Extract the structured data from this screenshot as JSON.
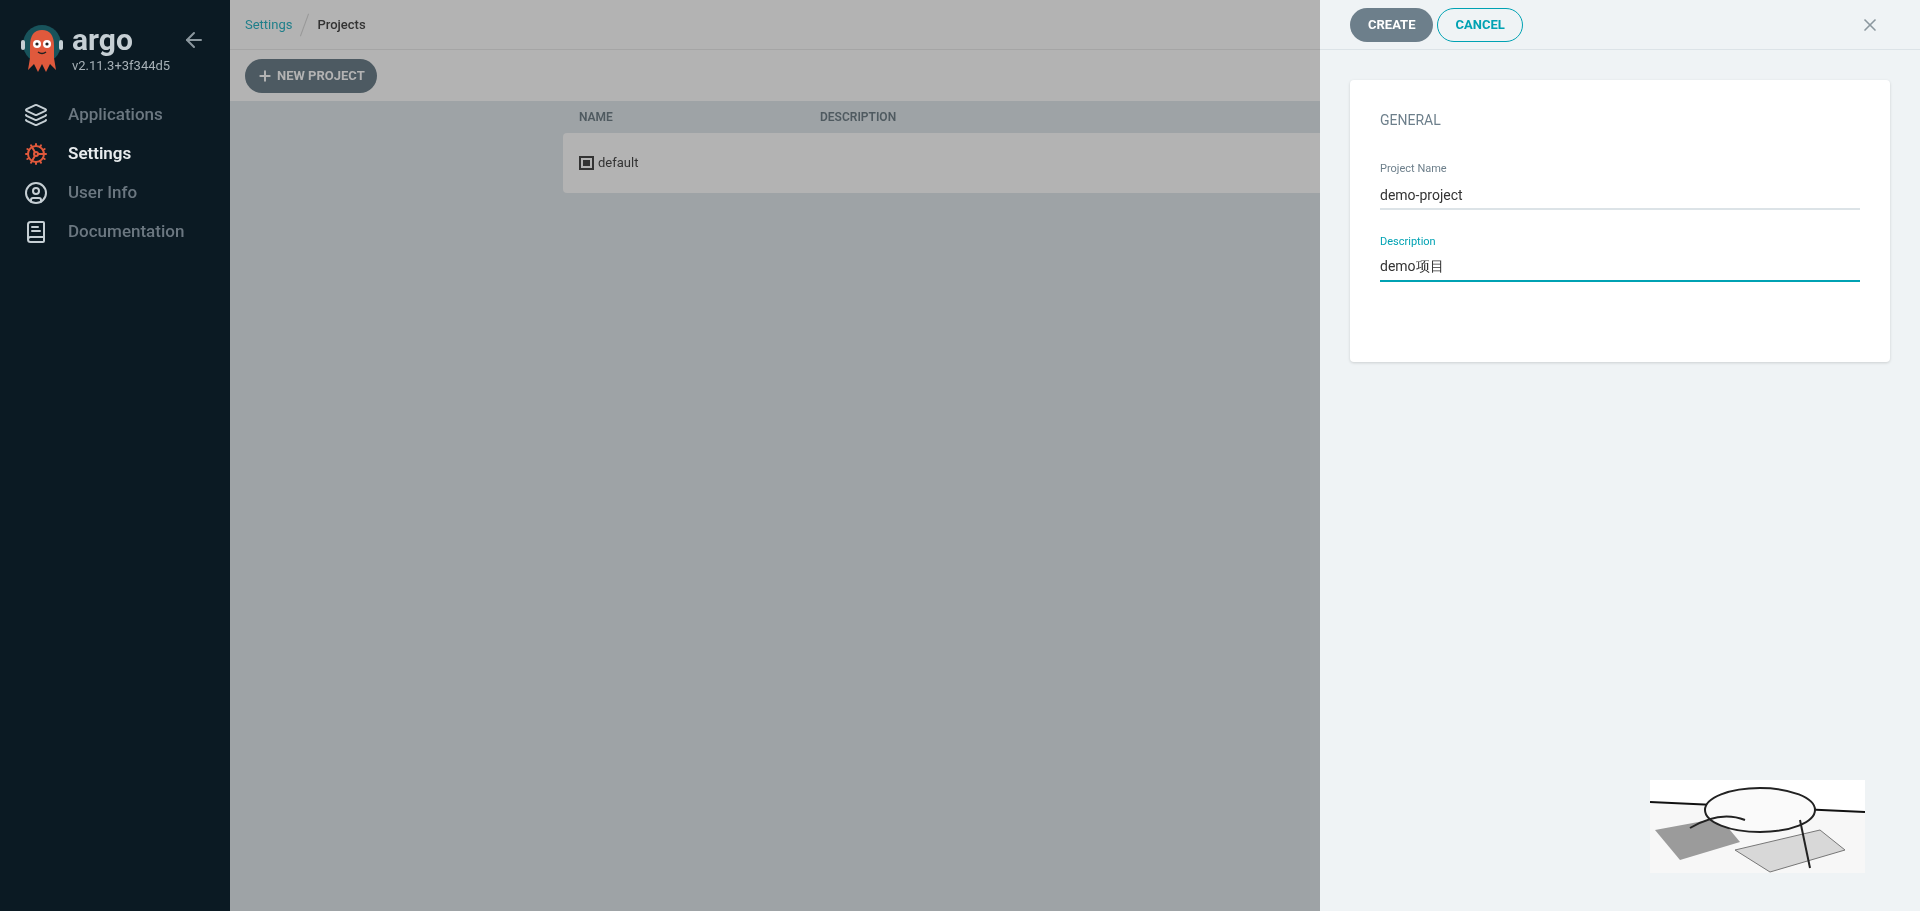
{
  "sidebar": {
    "logo_text": "argo",
    "version": "v2.11.3+3f344d5",
    "items": [
      {
        "label": "Applications",
        "kind": "layers",
        "selected": false
      },
      {
        "label": "Settings",
        "kind": "gears",
        "selected": true
      },
      {
        "label": "User Info",
        "kind": "user",
        "selected": false
      },
      {
        "label": "Documentation",
        "kind": "docs",
        "selected": false
      }
    ]
  },
  "breadcrumb": [
    {
      "label": "Settings",
      "kind": "link"
    },
    {
      "label": "Projects",
      "kind": "current"
    }
  ],
  "toolbar": {
    "new_button": "NEW PROJECT"
  },
  "table": {
    "columns": [
      "NAME",
      "DESCRIPTION"
    ],
    "rows": [
      {
        "name": "default"
      }
    ]
  },
  "panel": {
    "buttons": [
      {
        "label": "CREATE",
        "kind": "primary"
      },
      {
        "label": "CANCEL",
        "kind": "outline"
      }
    ],
    "section_title": "GENERAL",
    "fields": [
      {
        "label": "Project Name",
        "value": "demo-project",
        "focused": false
      },
      {
        "label": "Description",
        "value": "demo项目",
        "focused": true
      }
    ]
  }
}
